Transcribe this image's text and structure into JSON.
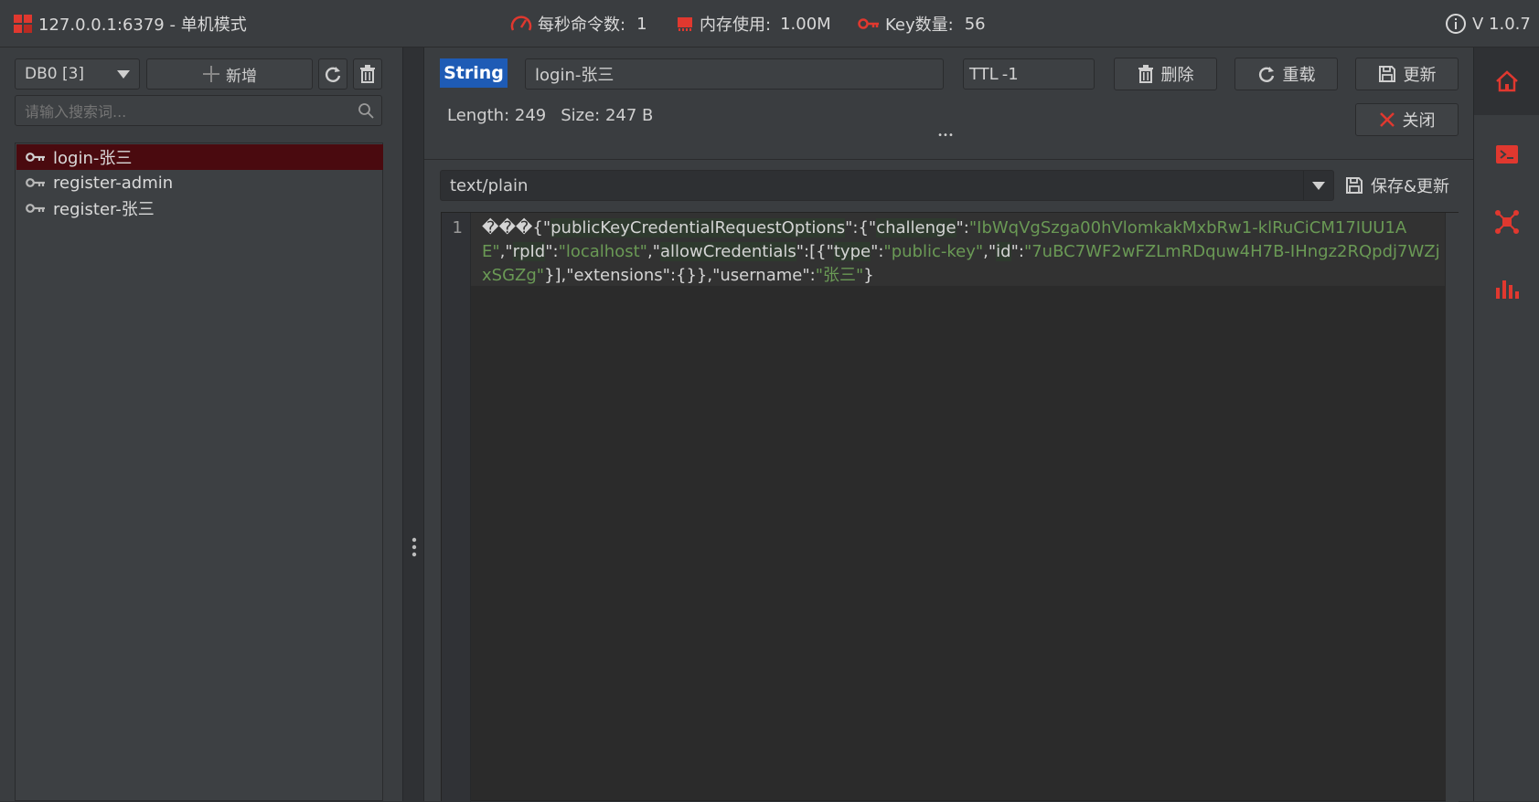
{
  "topbar": {
    "connection": "127.0.0.1:6379 - 单机模式",
    "ops_label": "每秒命令数:",
    "ops_value": "1",
    "mem_label": "内存使用:",
    "mem_value": "1.00M",
    "keys_label": "Key数量:",
    "keys_value": "56",
    "version": "V 1.0.7"
  },
  "left": {
    "db_select": "DB0 [3]",
    "add_label": "新增",
    "search_placeholder": "请输入搜索词...",
    "keys": [
      {
        "name": "login-张三",
        "selected": true
      },
      {
        "name": "register-admin",
        "selected": false
      },
      {
        "name": "register-张三",
        "selected": false
      }
    ]
  },
  "main": {
    "type_badge": "String",
    "key_name": "login-张三",
    "ttl_label": "TTL",
    "ttl_value": "-1",
    "delete_label": "删除",
    "reload_label": "重载",
    "update_label": "更新",
    "close_label": "关闭",
    "length_text": "Length: 249",
    "size_text": "Size: 247 B",
    "more_dots": "•••",
    "format_select": "text/plain",
    "save_update_label": "保存&更新",
    "line_number": "1",
    "code": [
      {
        "t": "���{\"",
        "c": "p"
      },
      {
        "t": "publicKeyCredentialRequestOptions",
        "c": "k"
      },
      {
        "t": "\":{\"",
        "c": "p"
      },
      {
        "t": "challenge",
        "c": "k"
      },
      {
        "t": "\":",
        "c": "p"
      },
      {
        "t": "\"IbWqVgSzga00hVlomkakMxbRw1-klRuCiCM17IUU1AE\"",
        "c": "s"
      },
      {
        "t": ",\"",
        "c": "p"
      },
      {
        "t": "rpId",
        "c": "k"
      },
      {
        "t": "\":",
        "c": "p"
      },
      {
        "t": "\"localhost\"",
        "c": "s"
      },
      {
        "t": ",\"",
        "c": "p"
      },
      {
        "t": "allowCredentials",
        "c": "k"
      },
      {
        "t": "\":[{\"",
        "c": "p"
      },
      {
        "t": "type",
        "c": "k"
      },
      {
        "t": "\":",
        "c": "p"
      },
      {
        "t": "\"public-key\"",
        "c": "s"
      },
      {
        "t": ",\"",
        "c": "p"
      },
      {
        "t": "id",
        "c": "k"
      },
      {
        "t": "\":",
        "c": "p"
      },
      {
        "t": "\"7uBC7WF2wFZLmRDquw4H7B-IHngz2RQpdj7WZjxSGZg\"",
        "c": "s"
      },
      {
        "t": "}],\"extensions\":{}},\"username\":",
        "c": "p"
      },
      {
        "t": "\"张三\"",
        "c": "s"
      },
      {
        "t": "}",
        "c": "p"
      }
    ]
  },
  "colors": {
    "accent_red": "#e0382f",
    "selected_row": "#4a0a0f",
    "badge_blue": "#1e5bb5"
  }
}
